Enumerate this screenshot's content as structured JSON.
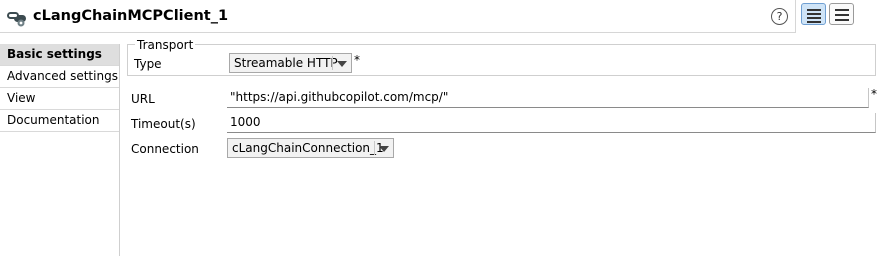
{
  "header": {
    "title": "cLangChainMCPClient_1",
    "component_icon": "langchain-component-icon",
    "help_icon": "help-icon",
    "help_glyph": "?",
    "view_buttons": [
      "list-view-icon",
      "table-view-icon"
    ]
  },
  "sidebar": {
    "items": [
      {
        "label": "Basic settings",
        "active": true
      },
      {
        "label": "Advanced settings"
      },
      {
        "label": "View"
      },
      {
        "label": "Documentation"
      }
    ]
  },
  "form": {
    "transport": {
      "legend": "Transport",
      "type_label": "Type",
      "type_value": "Streamable HTTP",
      "required": "*"
    },
    "url": {
      "label": "URL",
      "value": "\"https://api.githubcopilot.com/mcp/\"",
      "required": "*"
    },
    "timeout": {
      "label": "Timeout(s)",
      "value": "1000"
    },
    "connection": {
      "label": "Connection",
      "value": "cLangChainConnection_1"
    }
  },
  "colors": {
    "active_tab_bg": "#dedede",
    "active_view_button": "#cfe4f7",
    "combo_bg": "#f2f2f2"
  }
}
